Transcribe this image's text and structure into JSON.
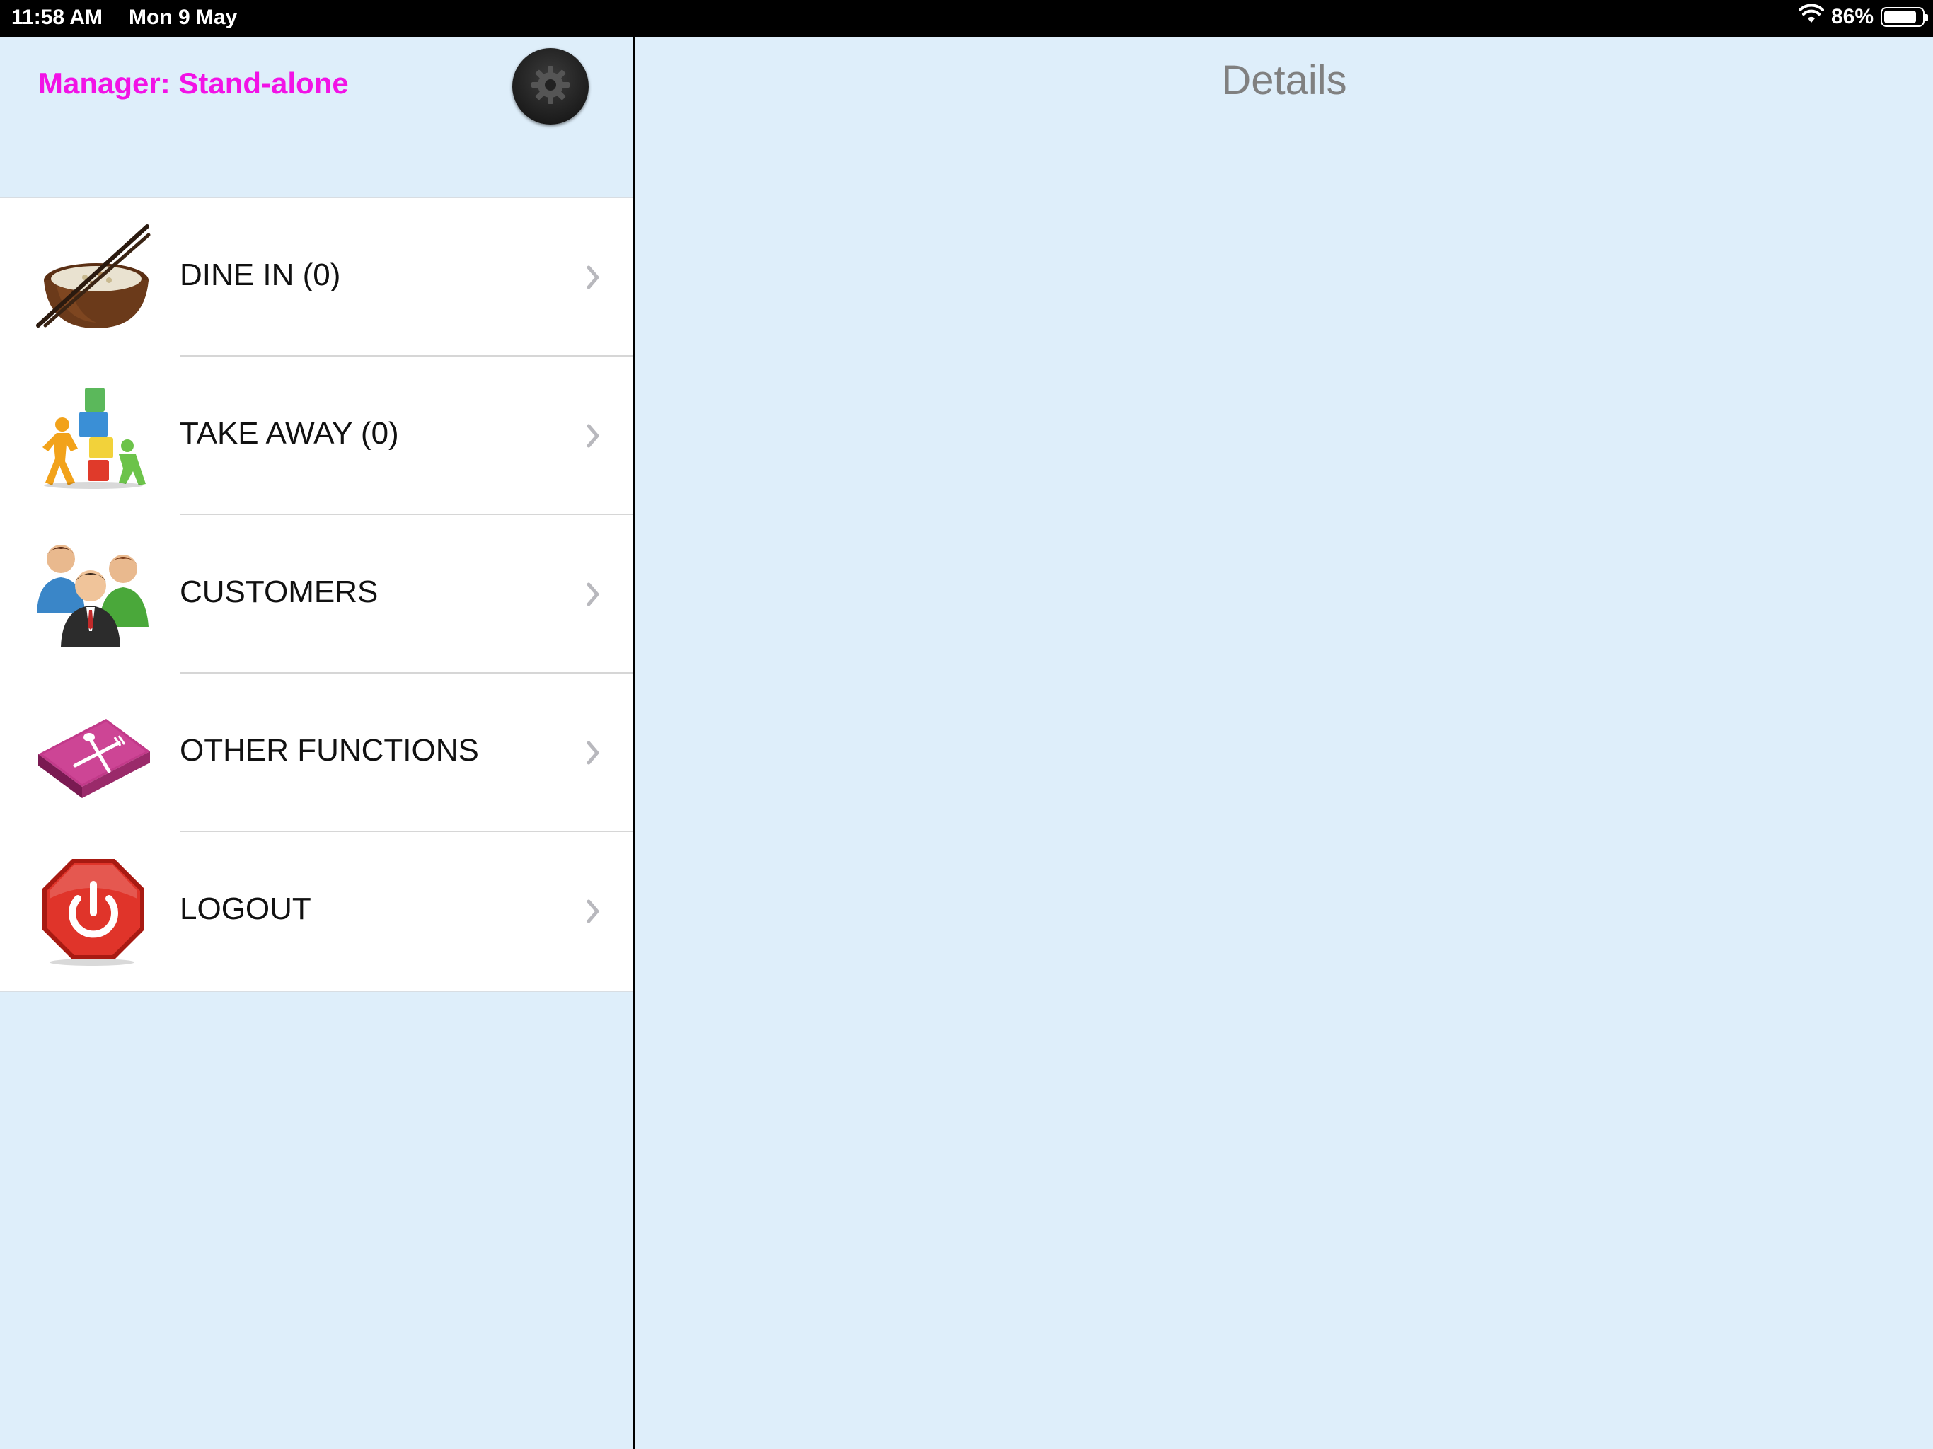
{
  "status_bar": {
    "time": "11:58 AM",
    "date": "Mon 9 May",
    "battery_pct": "86%",
    "battery_level": 0.86,
    "wifi_icon": "wifi-icon"
  },
  "master": {
    "manager_label": "Manager: Stand-alone",
    "settings_icon": "gear-icon",
    "menu": [
      {
        "label": "DINE IN (0)",
        "icon": "rice-bowl-icon"
      },
      {
        "label": "TAKE AWAY (0)",
        "icon": "delivery-boxes-icon"
      },
      {
        "label": "CUSTOMERS",
        "icon": "people-group-icon"
      },
      {
        "label": "OTHER FUNCTIONS",
        "icon": "menu-book-icon"
      },
      {
        "label": "LOGOUT",
        "icon": "power-icon"
      }
    ]
  },
  "detail": {
    "title": "Details"
  },
  "colors": {
    "accent": "#f212e6",
    "background": "#deeefa",
    "title_gray": "#808080"
  }
}
